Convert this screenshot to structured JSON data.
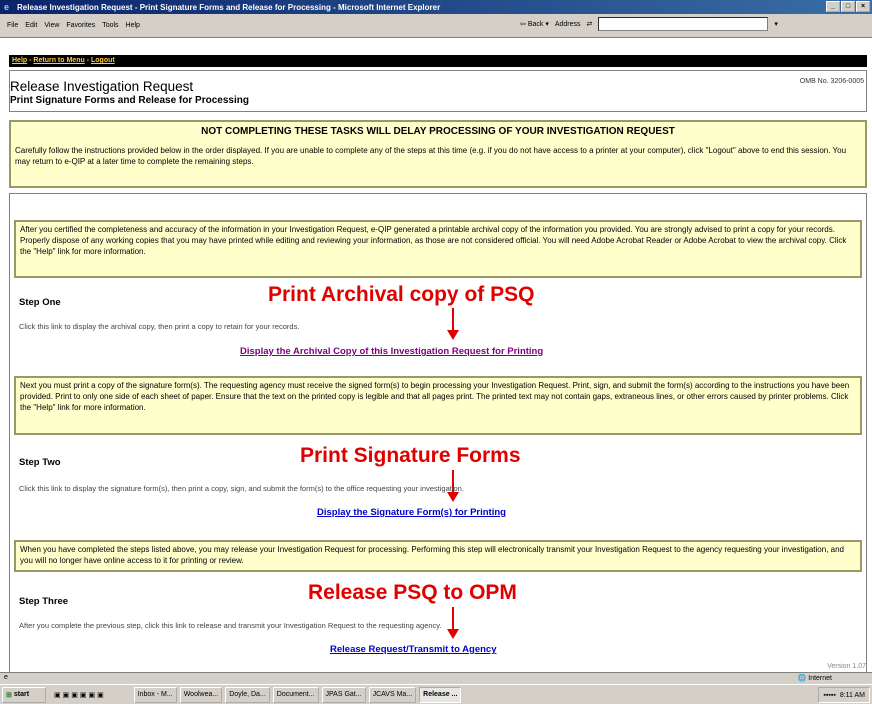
{
  "window": {
    "title": "Release Investigation Request - Print Signature Forms and Release for Processing - Microsoft Internet Explorer"
  },
  "menu": {
    "items": [
      "File",
      "Edit",
      "View",
      "Favorites",
      "Tools",
      "Help"
    ],
    "back_label": "Back",
    "address_label": "Address"
  },
  "nav": {
    "help": "Help",
    "return": "Return to Menu",
    "logout": "Logout",
    "separator": "-"
  },
  "header": {
    "title": "Release Investigation Request",
    "subtitle": "Print Signature Forms and Release for Processing",
    "omb": "OMB No. 3206-0005"
  },
  "warning": {
    "title": "NOT COMPLETING THESE TASKS WILL DELAY PROCESSING OF YOUR INVESTIGATION REQUEST",
    "text": "Carefully follow the instructions provided below in the order displayed. If you are unable to complete any of the steps at this time (e.g. if you do not have access to a printer at your computer), click \"Logout\" above to end this session. You may return to e-QIP at a later time to complete the remaining steps."
  },
  "step1": {
    "info": "After you certified the completeness and accuracy of the information in your Investigation Request, e-QIP generated a printable archival copy of the information you provided. You are strongly advised to print a copy for your records. Properly dispose of any working copies that you may have printed while editing and reviewing your information, as those are not considered official. You will need Adobe Acrobat Reader or Adobe Acrobat to view the archival copy. Click the \"Help\" link for more information.",
    "title": "Step One",
    "text": "Click this link to display the archival copy, then print a copy to retain for your records.",
    "link": "Display the Archival Copy of this Investigation Request for Printing",
    "annotation": "Print Archival copy of PSQ"
  },
  "step2": {
    "info": "Next you must print a copy of the signature form(s). The requesting agency must receive the signed form(s) to begin processing your Investigation Request. Print, sign, and submit the form(s) according to the instructions you have been provided. Print to only one side of each sheet of paper. Ensure that the text on the printed copy is legible and that all pages print. The printed text may not contain gaps, extraneous lines, or other errors caused by printer problems. Click the \"Help\" link for more information.",
    "title": "Step Two",
    "text": "Click this link to display the signature form(s), then print a copy, sign, and submit the form(s) to the office requesting your investigation.",
    "link": "Display the Signature Form(s) for Printing",
    "annotation": "Print Signature Forms"
  },
  "step3": {
    "info": "When you have completed the steps listed above, you may release your Investigation Request for processing. Performing this step will electronically transmit your Investigation Request to the agency requesting your investigation, and you will no longer have online access to it for printing or review.",
    "title": "Step Three",
    "text": "After you complete the previous step, click this link to release and transmit your Investigation Request to the requesting agency.",
    "link": "Release Request/Transmit to Agency",
    "annotation": "Release PSQ to OPM"
  },
  "version": "Version 1.07",
  "status": {
    "zone": "Internet"
  },
  "taskbar": {
    "start": "start",
    "tasks": [
      "Inbox - M...",
      "Woolwea...",
      "Doyle, Da...",
      "Document...",
      "JPAS Gat...",
      "JCAVS Ma...",
      "Release ..."
    ],
    "clock": "8:11 AM"
  },
  "colors": {
    "annotation": "#e00000",
    "link_visited": "#800080",
    "link": "#0000cc",
    "info_bg": "#ffffcc"
  }
}
